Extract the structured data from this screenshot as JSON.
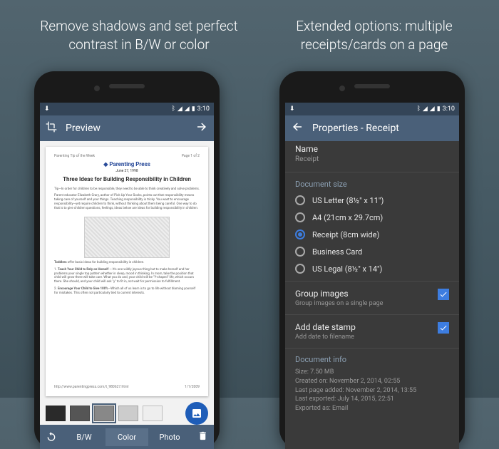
{
  "captions": {
    "left": "Remove shadows and set perfect contrast in B/W or color",
    "right": "Extended options: multiple receipts/cards on a page"
  },
  "statusbar": {
    "time": "3:10"
  },
  "left": {
    "appbar": {
      "title": "Preview"
    },
    "document": {
      "header_left": "Parenting Tip of the Week",
      "header_right": "Page 1 of 2",
      "brand": "Parenting Press",
      "date": "June 27, 1998",
      "title": "Three Ideas for Building Responsibility in Children",
      "footer_left": "http://www.parentingpress.com/t_980627.html",
      "footer_right": "1/1/2009"
    },
    "bottombar": {
      "bw": "B/W",
      "color": "Color",
      "photo": "Photo"
    }
  },
  "right": {
    "appbar": {
      "title": "Properties - Receipt"
    },
    "name": {
      "label": "Name",
      "value": "Receipt"
    },
    "docsize": {
      "label": "Document size",
      "options": {
        "usletter": "US Letter (8½\" x 11\")",
        "a4": "A4 (21cm x 29.7cm)",
        "receipt": "Receipt (8cm wide)",
        "bizcard": "Business Card",
        "uslegal": "US Legal (8½\" x 14\")"
      }
    },
    "group": {
      "label": "Group images",
      "sub": "Group images on a single page"
    },
    "datestamp": {
      "label": "Add date stamp",
      "sub": "Add date to filename"
    },
    "info": {
      "title": "Document info",
      "size": "Size: 7.50 MB",
      "created": "Created on: November 2, 2014, 02:55",
      "lastpage": "Last page added: November 2, 2014, 13:55",
      "lastexp": "Last exported: July 14, 2015, 22:51",
      "expas": "Exported as: Email"
    }
  }
}
